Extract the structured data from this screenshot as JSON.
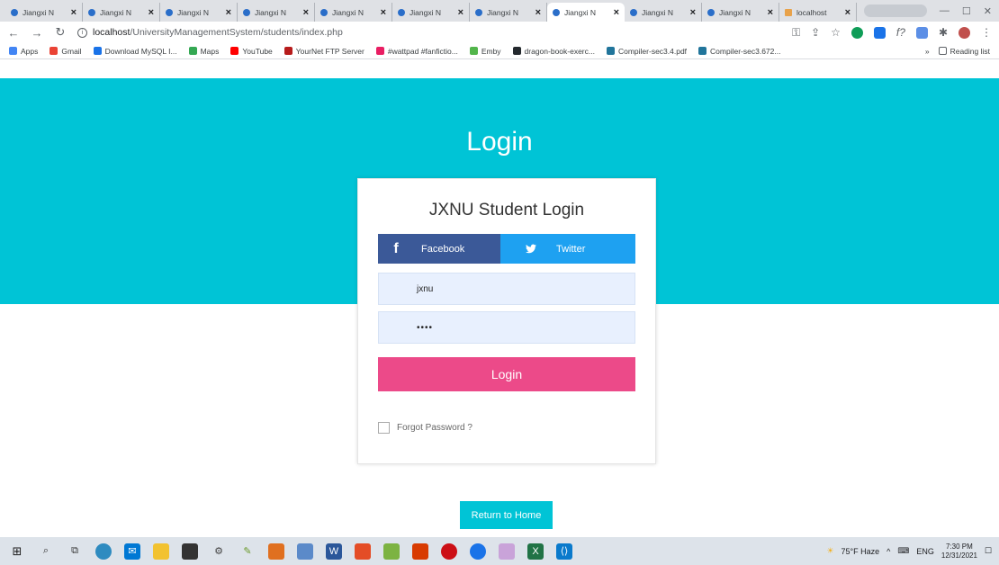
{
  "browser": {
    "tabs": [
      {
        "title": "Jiangxi N",
        "active": false
      },
      {
        "title": "Jiangxi N",
        "active": false
      },
      {
        "title": "Jiangxi N",
        "active": false
      },
      {
        "title": "Jiangxi N",
        "active": false
      },
      {
        "title": "Jiangxi N",
        "active": false
      },
      {
        "title": "Jiangxi N",
        "active": false
      },
      {
        "title": "Jiangxi N",
        "active": false
      },
      {
        "title": "Jiangxi N",
        "active": true
      },
      {
        "title": "Jiangxi N",
        "active": false
      },
      {
        "title": "Jiangxi N",
        "active": false
      },
      {
        "title": "localhost",
        "active": false
      }
    ],
    "tab_close": "×",
    "new_tab": "+",
    "address": {
      "host": "localhost",
      "path": "/UniversityManagementSystem/students/index.php"
    },
    "bookmarks": [
      {
        "label": "Apps",
        "color": "#4285f4"
      },
      {
        "label": "Gmail",
        "color": "#ea4335"
      },
      {
        "label": "Download MySQL I...",
        "color": "#1a73e8"
      },
      {
        "label": "Maps",
        "color": "#34a853"
      },
      {
        "label": "YouTube",
        "color": "#ff0000"
      },
      {
        "label": "YourNet FTP Server",
        "color": "#b71c1c"
      },
      {
        "label": "#wattpad #fanfictio...",
        "color": "#e91e63"
      },
      {
        "label": "Emby",
        "color": "#52b54b"
      },
      {
        "label": "dragon-book-exerc...",
        "color": "#24292e"
      },
      {
        "label": "Compiler-sec3.4.pdf",
        "color": "#21759b"
      },
      {
        "label": "Compiler-sec3.672...",
        "color": "#21759b"
      }
    ],
    "more_bookmarks": "»",
    "reading_list": "Reading list"
  },
  "page": {
    "hero_title": "Login",
    "card_title": "JXNU Student Login",
    "facebook_label": "Facebook",
    "twitter_label": "Twitter",
    "username_value": "jxnu",
    "password_value": "••••",
    "login_button": "Login",
    "forgot_label": "Forgot Password ?",
    "return_home": "Return to Home",
    "colors": {
      "hero": "#00c4d6",
      "login": "#ec4a89",
      "facebook": "#3b5998",
      "twitter": "#1ea1f1"
    }
  },
  "taskbar": {
    "weather": "75°F Haze",
    "lang": "ENG",
    "time": "7:30 PM",
    "date": "12/31/2021"
  }
}
